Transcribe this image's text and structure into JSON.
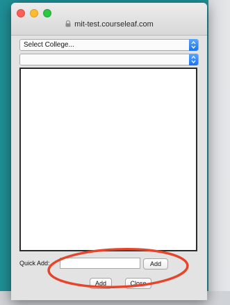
{
  "browser": {
    "url": "mit-test.courseleaf.com"
  },
  "form": {
    "college_select": {
      "value": "Select College..."
    },
    "second_select": {
      "value": ""
    },
    "quick_add": {
      "label": "Quick Add:",
      "value": "",
      "add_label": "Add"
    },
    "add_label": "Add",
    "close_label": "Close"
  },
  "annotation": {
    "color": "#e5452b",
    "shape": "ellipse"
  }
}
